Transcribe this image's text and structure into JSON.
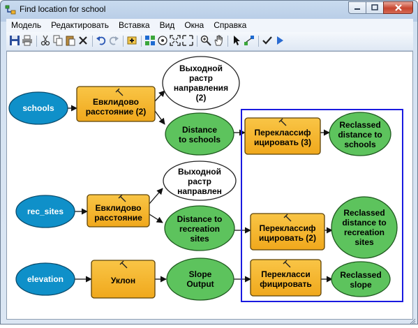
{
  "window": {
    "title": "Find location for school"
  },
  "menu": [
    "Модель",
    "Редактировать",
    "Вставка",
    "Вид",
    "Окна",
    "Справка"
  ],
  "toolbar": {
    "icons": [
      "save-icon",
      "print-icon",
      "cut-icon",
      "copy-icon",
      "paste-icon",
      "delete-icon",
      "undo-icon",
      "redo-icon",
      "add-data-icon",
      "auto-layout-icon",
      "full-extent-icon",
      "fit-to-window-icon",
      "zoom-in-icon",
      "pan-icon",
      "select-icon",
      "connect-icon",
      "validate-icon",
      "run-icon"
    ]
  },
  "colors": {
    "input_blue": "#0f90c9",
    "tool_yellow": "#f7b42a",
    "output_green": "#5dc35d",
    "intermediate_white": "#ffffff",
    "selection_blue": "#1a1ae0"
  },
  "model": {
    "inputs": {
      "schools": "schools",
      "rec_sites": "rec_sites",
      "elevation": "elevation"
    },
    "tools": {
      "euclid_2": [
        "Евклидово",
        "расстояние (2)"
      ],
      "euclid_1": [
        "Евклидово",
        "расстояние"
      ],
      "slope": [
        "Уклон"
      ],
      "reclass_3": [
        "Переклассиф",
        "ицировать (3)"
      ],
      "reclass_2": [
        "Переклассиф",
        "ицировать (2)"
      ],
      "reclass_1": [
        "Перекласси",
        "фицировать"
      ]
    },
    "outputs": {
      "dir_raster_2": [
        "Выходной",
        "растр",
        "направления",
        "(2)"
      ],
      "dir_raster_1": [
        "Выходной",
        "растр",
        "направлен"
      ],
      "dist_schools": [
        "Distance",
        "to schools"
      ],
      "dist_rec": [
        "Distance to",
        "recreation",
        "sites"
      ],
      "slope_output": [
        "Slope",
        "Output"
      ],
      "rc_schools": [
        "Reclassed",
        "distance to",
        "schools"
      ],
      "rc_rec": [
        "Reclassed",
        "distance to",
        "recreation",
        "sites"
      ],
      "rc_slope": [
        "Reclassed",
        "slope"
      ]
    }
  }
}
